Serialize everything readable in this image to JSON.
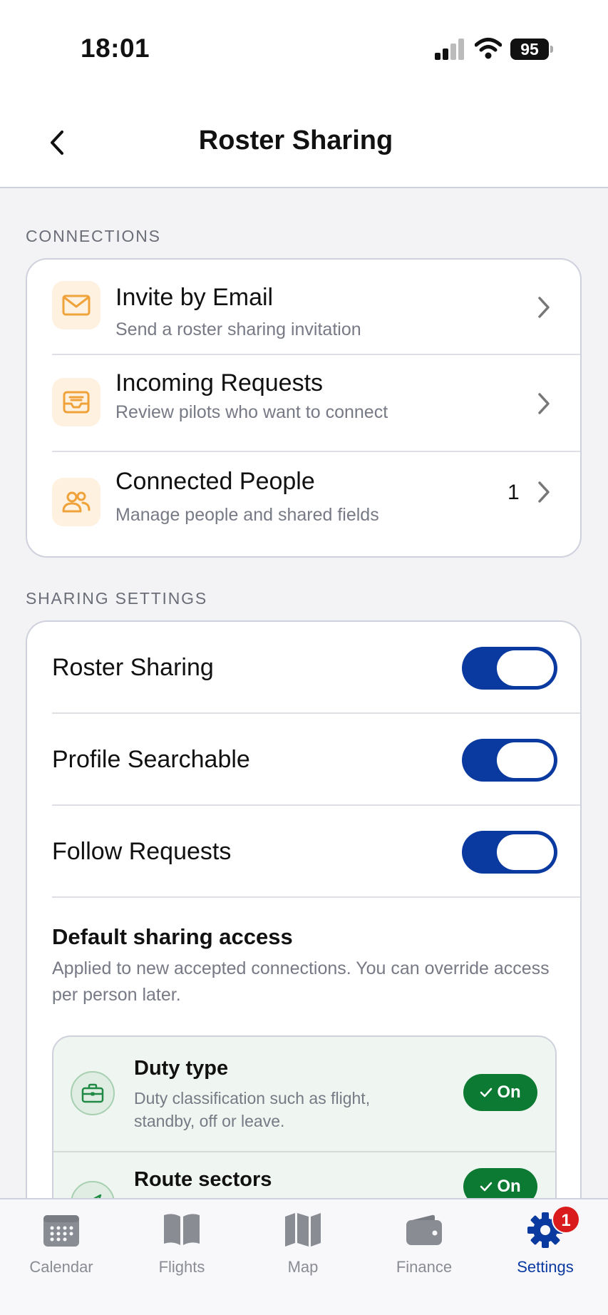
{
  "status_bar": {
    "time": "18:01",
    "battery": "95"
  },
  "nav": {
    "title": "Roster Sharing"
  },
  "connections": {
    "section_label": "CONNECTIONS",
    "items": [
      {
        "title": "Invite by Email",
        "subtitle": "Send a roster sharing invitation",
        "icon": "mail-icon",
        "count": ""
      },
      {
        "title": "Incoming Requests",
        "subtitle": "Review pilots who want to connect",
        "icon": "inbox-icon",
        "count": ""
      },
      {
        "title": "Connected People",
        "subtitle": "Manage people and shared fields",
        "icon": "people-icon",
        "count": "1"
      }
    ]
  },
  "sharing_settings": {
    "section_label": "SHARING SETTINGS",
    "toggles": [
      {
        "label": "Roster Sharing",
        "on": true
      },
      {
        "label": "Profile Searchable",
        "on": true
      },
      {
        "label": "Follow Requests",
        "on": true
      }
    ],
    "default_access": {
      "title": "Default sharing access",
      "description": "Applied to new accepted connections. You can override access per person later.",
      "items": [
        {
          "title": "Duty type",
          "description": "Duty classification such as flight, standby, off or leave.",
          "state": "On",
          "icon": "briefcase-icon"
        },
        {
          "title": "Route sectors",
          "description": "",
          "state": "On",
          "icon": "plane-icon"
        }
      ]
    }
  },
  "tabbar": {
    "tabs": [
      {
        "label": "Calendar",
        "icon": "calendar-icon",
        "active": false
      },
      {
        "label": "Flights",
        "icon": "book-icon",
        "active": false
      },
      {
        "label": "Map",
        "icon": "map-icon",
        "active": false
      },
      {
        "label": "Finance",
        "icon": "wallet-icon",
        "active": false
      },
      {
        "label": "Settings",
        "icon": "gear-icon",
        "active": true,
        "badge": "1"
      }
    ]
  },
  "colors": {
    "accent": "#0a3aa0",
    "on_green": "#0c7a32",
    "icon_orange": "#f0a23a",
    "badge_red": "#d91b1b"
  }
}
